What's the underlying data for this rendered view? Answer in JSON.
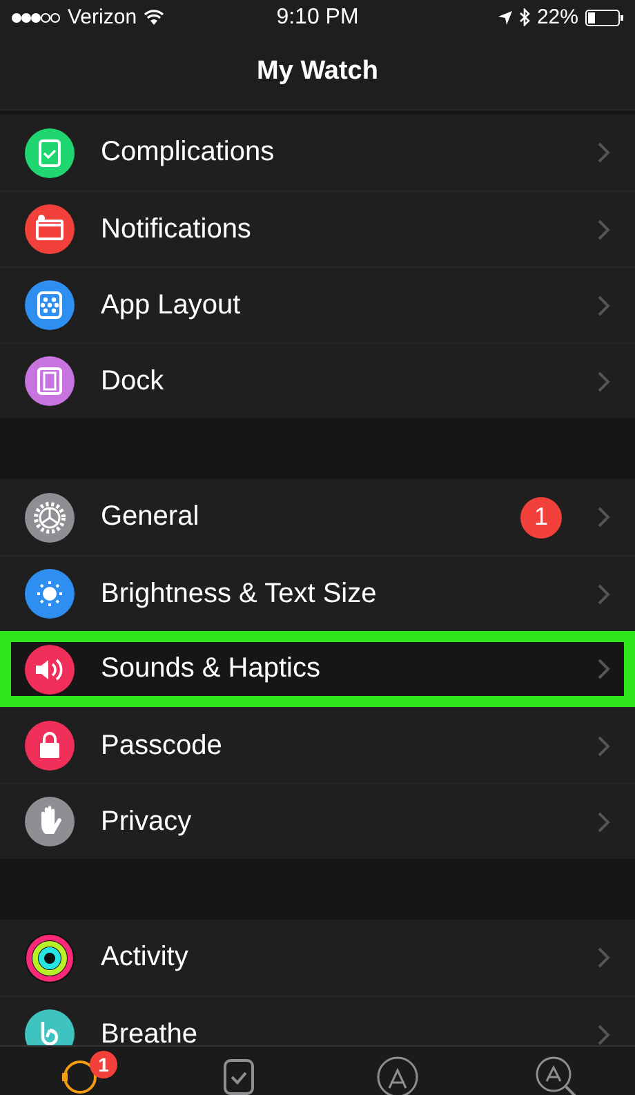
{
  "status_bar": {
    "carrier": "Verizon",
    "time": "9:10 PM",
    "battery": "22%"
  },
  "nav": {
    "title": "My Watch"
  },
  "groups": [
    {
      "items": [
        {
          "label": "Complications",
          "color": "#1fd671",
          "highlighted": false
        },
        {
          "label": "Notifications",
          "color": "#f2413a",
          "highlighted": false
        },
        {
          "label": "App Layout",
          "color": "#2f8ff0",
          "highlighted": false
        },
        {
          "label": "Dock",
          "color": "#c774e0",
          "highlighted": false
        }
      ]
    },
    {
      "items": [
        {
          "label": "General",
          "color": "#8e8e93",
          "badge": "1",
          "highlighted": false
        },
        {
          "label": "Brightness & Text Size",
          "color": "#2f8ff0",
          "highlighted": false
        },
        {
          "label": "Sounds & Haptics",
          "color": "#f0305a",
          "highlighted": true
        },
        {
          "label": "Passcode",
          "color": "#f0305a",
          "highlighted": false
        },
        {
          "label": "Privacy",
          "color": "#8e8e93",
          "highlighted": false
        }
      ]
    },
    {
      "items": [
        {
          "label": "Activity",
          "color": "#111111",
          "highlighted": false
        },
        {
          "label": "Breathe",
          "color": "#3fc3c0",
          "highlighted": false
        }
      ]
    }
  ],
  "tabs": [
    {
      "selected": true,
      "badge": "1"
    },
    {
      "selected": false
    },
    {
      "selected": false
    },
    {
      "selected": false
    }
  ]
}
